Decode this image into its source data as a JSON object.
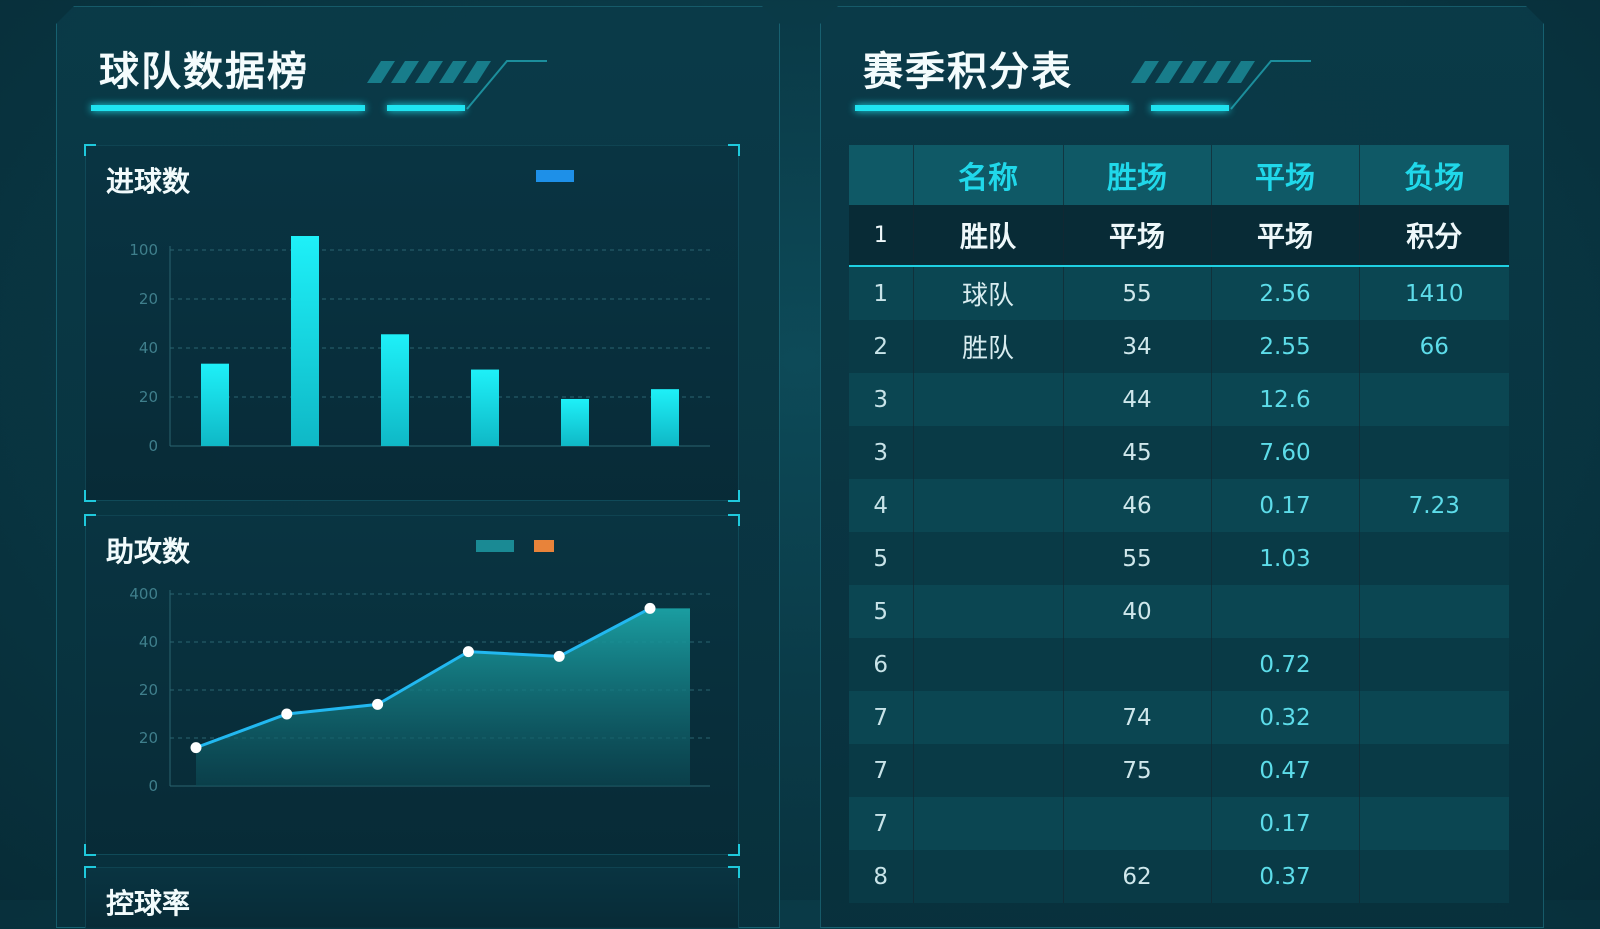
{
  "left_panel": {
    "title": "球队数据榜"
  },
  "right_panel": {
    "title": "赛季积分表"
  },
  "goals_chart": {
    "title": "进球数",
    "legend": [
      "",
      ""
    ]
  },
  "assists_chart": {
    "title": "助攻数",
    "legend": [
      "",
      ""
    ]
  },
  "third_card": {
    "title": "控球率"
  },
  "colors": {
    "accent": "#1fe3f0",
    "bar": "#14e6f2",
    "line": "#22b8f0",
    "area": "#1a9aa0",
    "legend_orange": "#e8833a",
    "legend_blue": "#1e90e8"
  },
  "chart_data": [
    {
      "type": "bar",
      "title": "进球数",
      "categories": [
        "",
        "",
        "",
        "",
        "",
        ""
      ],
      "values": [
        42,
        108,
        57,
        39,
        24,
        29
      ],
      "ylim": [
        0,
        100
      ],
      "yticks": [
        "0",
        "20",
        "40",
        "20",
        "100"
      ],
      "grid": true,
      "legend_position": "top-right"
    },
    {
      "type": "area",
      "title": "助攻数",
      "categories": [
        "",
        "",
        "",
        "",
        "",
        ""
      ],
      "values": [
        8,
        15,
        17,
        28,
        27,
        37
      ],
      "ylim": [
        0,
        40
      ],
      "yticks": [
        "0",
        "20",
        "20",
        "40",
        "400"
      ],
      "grid": true,
      "legend_position": "top-right"
    }
  ],
  "standings": {
    "headers": [
      "",
      "名称",
      "胜场",
      "平场",
      "负场"
    ],
    "subheader": [
      "1",
      "胜队",
      "平场",
      "平场",
      "积分"
    ],
    "rows": [
      [
        "1",
        "球队",
        "55",
        "2.56",
        "1410"
      ],
      [
        "2",
        "胜队",
        "34",
        "2.55",
        "66"
      ],
      [
        "3",
        "",
        "44",
        "12.6",
        ""
      ],
      [
        "3",
        "",
        "45",
        "7.60",
        ""
      ],
      [
        "4",
        "",
        "46",
        "0.17",
        "7.23"
      ],
      [
        "5",
        "",
        "55",
        "1.03",
        ""
      ],
      [
        "5",
        "",
        "40",
        "",
        ""
      ],
      [
        "6",
        "",
        "",
        "0.72",
        ""
      ],
      [
        "7",
        "",
        "74",
        "0.32",
        ""
      ],
      [
        "7",
        "",
        "75",
        "0.47",
        ""
      ],
      [
        "7",
        "",
        "",
        "0.17",
        ""
      ],
      [
        "8",
        "",
        "62",
        "0.37",
        ""
      ]
    ]
  }
}
